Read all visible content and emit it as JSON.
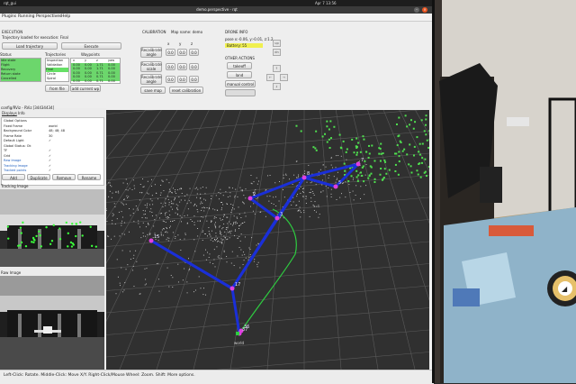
{
  "system_bar": {
    "app_label": "rqt_gui",
    "clock": "Apr 7  13:56"
  },
  "window": {
    "title": "demo.perspective - rqt"
  },
  "menubar": {
    "items": [
      "Plugins",
      "Running",
      "Perspectives",
      "Help"
    ]
  },
  "execution": {
    "header": "EXECUTION",
    "loaded_text": "Trajectory loaded for execution: Final",
    "load_button": "Load trajectory",
    "execute_button": "Execute"
  },
  "status": {
    "header": "Status",
    "items": [
      "Idle state",
      "Flight",
      "Recovery",
      "Return state",
      "Cancelled"
    ]
  },
  "trajectories": {
    "header": "Trajectories",
    "items": [
      "Inspection",
      "Validation",
      "Final",
      "Circle",
      "Spiral"
    ],
    "from_file_button": "from file"
  },
  "waypoints": {
    "header": "Waypoints",
    "columns": [
      "x",
      "y",
      "z",
      "yaw"
    ],
    "rows": [
      [
        "0.00",
        "0.00",
        "1.71",
        "0.00"
      ],
      [
        "0.00",
        "0.00",
        "1.71",
        "0.00"
      ],
      [
        "0.00",
        "0.00",
        "0.71",
        "0.00"
      ],
      [
        "0.00",
        "0.00",
        "0.71",
        "0.00"
      ],
      [
        "0.00",
        "0.00",
        "0.71",
        "0.00"
      ]
    ],
    "add_button": "add current wp"
  },
  "calibration": {
    "header": "CALIBRATION",
    "map_name": "Map name: demo",
    "col_labels": [
      "x",
      "y",
      "z"
    ],
    "recalibrate_angle": "Recalibrate angle",
    "recalibrate_scale": "Recalibrate scale",
    "recalibrate_angle_2": "Recalibrate angle",
    "save_map": "save map",
    "reset_calibration": "reset calibration",
    "field_values": [
      "0.0",
      "0.0",
      "0.0"
    ]
  },
  "drone": {
    "header": "DRONE INFO",
    "pose": "pose x:-0.06, y:-0.01, z:1.2",
    "battery": "Battery: 55",
    "other_header": "OTHER ACTIONS",
    "takeoff": "takeoff",
    "land": "land",
    "manual_control": "manual control",
    "pad_labels": [
      "up",
      "dn"
    ],
    "jog_labels": [
      "←",
      "→",
      "↑",
      "↓"
    ]
  },
  "rviz": {
    "title": "config/RViz - RViz [34434434]",
    "tabs": [
      "Displays",
      "Info"
    ],
    "displays": [
      {
        "name": "Global Options",
        "value": ""
      },
      {
        "name": "Fixed Frame",
        "value": "world"
      },
      {
        "name": "Background Color",
        "value": "48; 48; 48"
      },
      {
        "name": "Frame Rate",
        "value": "30"
      },
      {
        "name": "Default Light",
        "value": "✓"
      },
      {
        "name": "Global Status: Ok",
        "value": ""
      },
      {
        "name": "TF",
        "value": "✓"
      },
      {
        "name": "Grid",
        "value": "✓"
      },
      {
        "name": "Raw Image",
        "value": "✓"
      },
      {
        "name": "Tracking Image",
        "value": "✓"
      },
      {
        "name": "Tracked points",
        "value": "✓"
      }
    ],
    "buttons": [
      "Add",
      "Duplicate",
      "Remove",
      "Rename"
    ],
    "tracking_header": "Tracking Image",
    "raw_header": "Raw Image"
  },
  "viewport": {
    "node_labels": [
      "17",
      "36",
      "37",
      "15",
      "2",
      "8",
      "7",
      "5",
      "3"
    ],
    "ground_label": "world"
  },
  "statusbar": {
    "text": "Left-Click: Rotate.  Middle-Click: Move X/Y.  Right-Click/Mouse Wheel: Zoom.  Shift: More options."
  },
  "colors": {
    "accent_green": "#6cd66c",
    "battery_yellow": "#f0f050",
    "path_blue": "#1a2fd8",
    "trajectory_green": "#2ecc40",
    "cloud_white": "#dcdcdc",
    "viewport_bg": "#303030"
  }
}
